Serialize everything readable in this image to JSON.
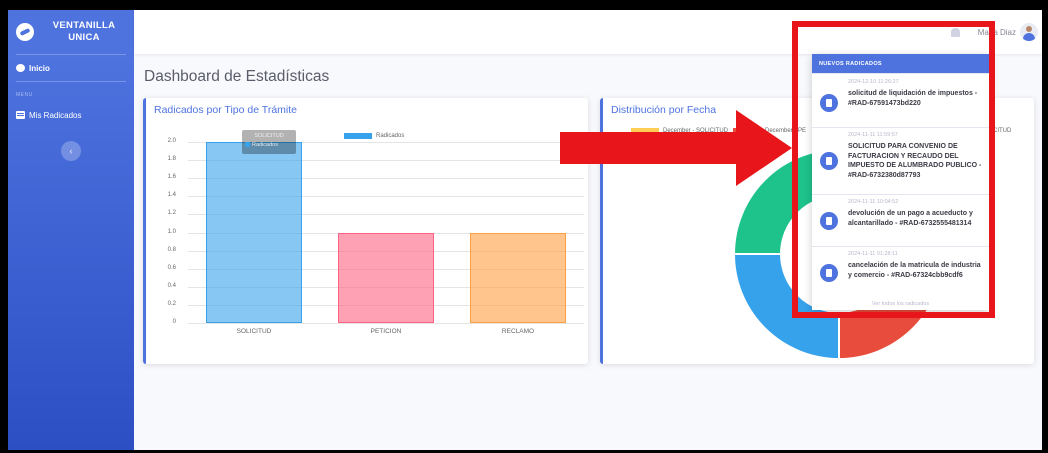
{
  "app": {
    "brand_line1": "VENTANILLA",
    "brand_line2": "UNICA"
  },
  "sidebar": {
    "inicio_label": "Inicio",
    "heading": "MENU",
    "items": [
      {
        "label": "Mis Radicados",
        "icon": "table-icon"
      }
    ],
    "toggle_glyph": "‹"
  },
  "topbar": {
    "user_name": "Maria Diaz",
    "bell_icon": "bell-icon"
  },
  "page": {
    "title": "Dashboard de Estadísticas"
  },
  "card_tipo": {
    "title": "Radicados por Tipo de Trámite",
    "tooltip_title": "SOLICITUD",
    "tooltip_label": "Radicados"
  },
  "card_fecha": {
    "title": "Distribución por Fecha",
    "legend": [
      {
        "label": "December - SOLICITUD",
        "color": "#ffcd56"
      },
      {
        "label": "December - PE",
        "color": "#e74c3c"
      },
      {
        "label": "CITUD",
        "color": "#36a2eb"
      }
    ]
  },
  "notifications": {
    "header": "NUEVOS RADICADOS",
    "items": [
      {
        "date": "2024-12-10 11:26:27",
        "text": "solicitud de liquidación de impuestos - #RAD-67591473bd220"
      },
      {
        "date": "2024-11-11 11:59:57",
        "text": "SOLICITUD PARA CONVENIO DE FACTURACION Y RECAUDO DEL IMPUESTO DE ALUMBRADO PUBLICO - #RAD-6732380d87793"
      },
      {
        "date": "2024-11-11 10:04:52",
        "text": "devolución de un pago a acueducto y alcantarillado - #RAD-6732555481314"
      },
      {
        "date": "2024-11-11 01:28:11",
        "text": "cancelación de la matricula de industria y comercio - #RAD-67324cbb9cdf6"
      }
    ],
    "footer": "Ver todos los radicados"
  },
  "chart_data": [
    {
      "type": "bar",
      "title": "Radicados por Tipo de Trámite",
      "categories": [
        "SOLICITUD",
        "PETICION",
        "RECLAMO"
      ],
      "series": [
        {
          "name": "Radicados",
          "values": [
            2,
            1,
            1
          ],
          "colors": [
            "#36a2eb",
            "#ff6384",
            "#ff9f40"
          ]
        }
      ],
      "y_ticks": [
        "2.0",
        "1.8",
        "1.6",
        "1.4",
        "1.2",
        "1.0",
        "0.8",
        "0.6",
        "0.4",
        "0.2",
        "0"
      ],
      "ylim": [
        0,
        2
      ],
      "grid": true,
      "legend_position": "top"
    },
    {
      "type": "pie",
      "title": "Distribución por Fecha",
      "donut": true,
      "slices": [
        {
          "label": "December - SOLICITUD",
          "value": 1,
          "color": "#ffcd56"
        },
        {
          "label": "December - PE",
          "value": 1,
          "color": "#e74c3c"
        },
        {
          "label": "CITUD",
          "value": 1,
          "color": "#36a2eb"
        },
        {
          "label": "",
          "value": 1,
          "color": "#1ec28b"
        }
      ],
      "legend_position": "top"
    }
  ],
  "colors": {
    "primary": "#4e73df",
    "annotation": "#e8151b"
  }
}
